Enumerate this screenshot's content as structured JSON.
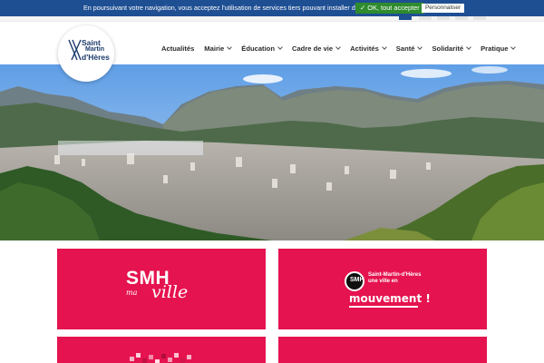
{
  "cookie_banner": {
    "text": "En poursuivant votre navigation, vous acceptez l'utilisation de services tiers pouvant installer des cookies",
    "accept_label": "✓ OK, tout accepter",
    "customize_label": "Personnaliser"
  },
  "logo": {
    "line1": "Saint",
    "line2": "Martin",
    "line3": "d'Hères"
  },
  "nav": {
    "items": [
      {
        "label": "Actualités",
        "has_dropdown": false
      },
      {
        "label": "Mairie",
        "has_dropdown": true
      },
      {
        "label": "Éducation",
        "has_dropdown": true
      },
      {
        "label": "Cadre de vie",
        "has_dropdown": true
      },
      {
        "label": "Activités",
        "has_dropdown": true
      },
      {
        "label": "Santé",
        "has_dropdown": true
      },
      {
        "label": "Solidarité",
        "has_dropdown": true
      },
      {
        "label": "Pratique",
        "has_dropdown": true
      }
    ]
  },
  "tiles": {
    "smh": {
      "title": "SMH",
      "subtitle": "ma",
      "accent": "ville"
    },
    "mouvement": {
      "badge": "SMH",
      "line1": "Saint-Martin-d'Hères",
      "line2": "une ville en",
      "line3": "mouvement !"
    }
  },
  "colors": {
    "banner": "#1f4f93",
    "accept": "#2e8b2e",
    "tile": "#e5134f",
    "brand": "#1b3a6b"
  }
}
